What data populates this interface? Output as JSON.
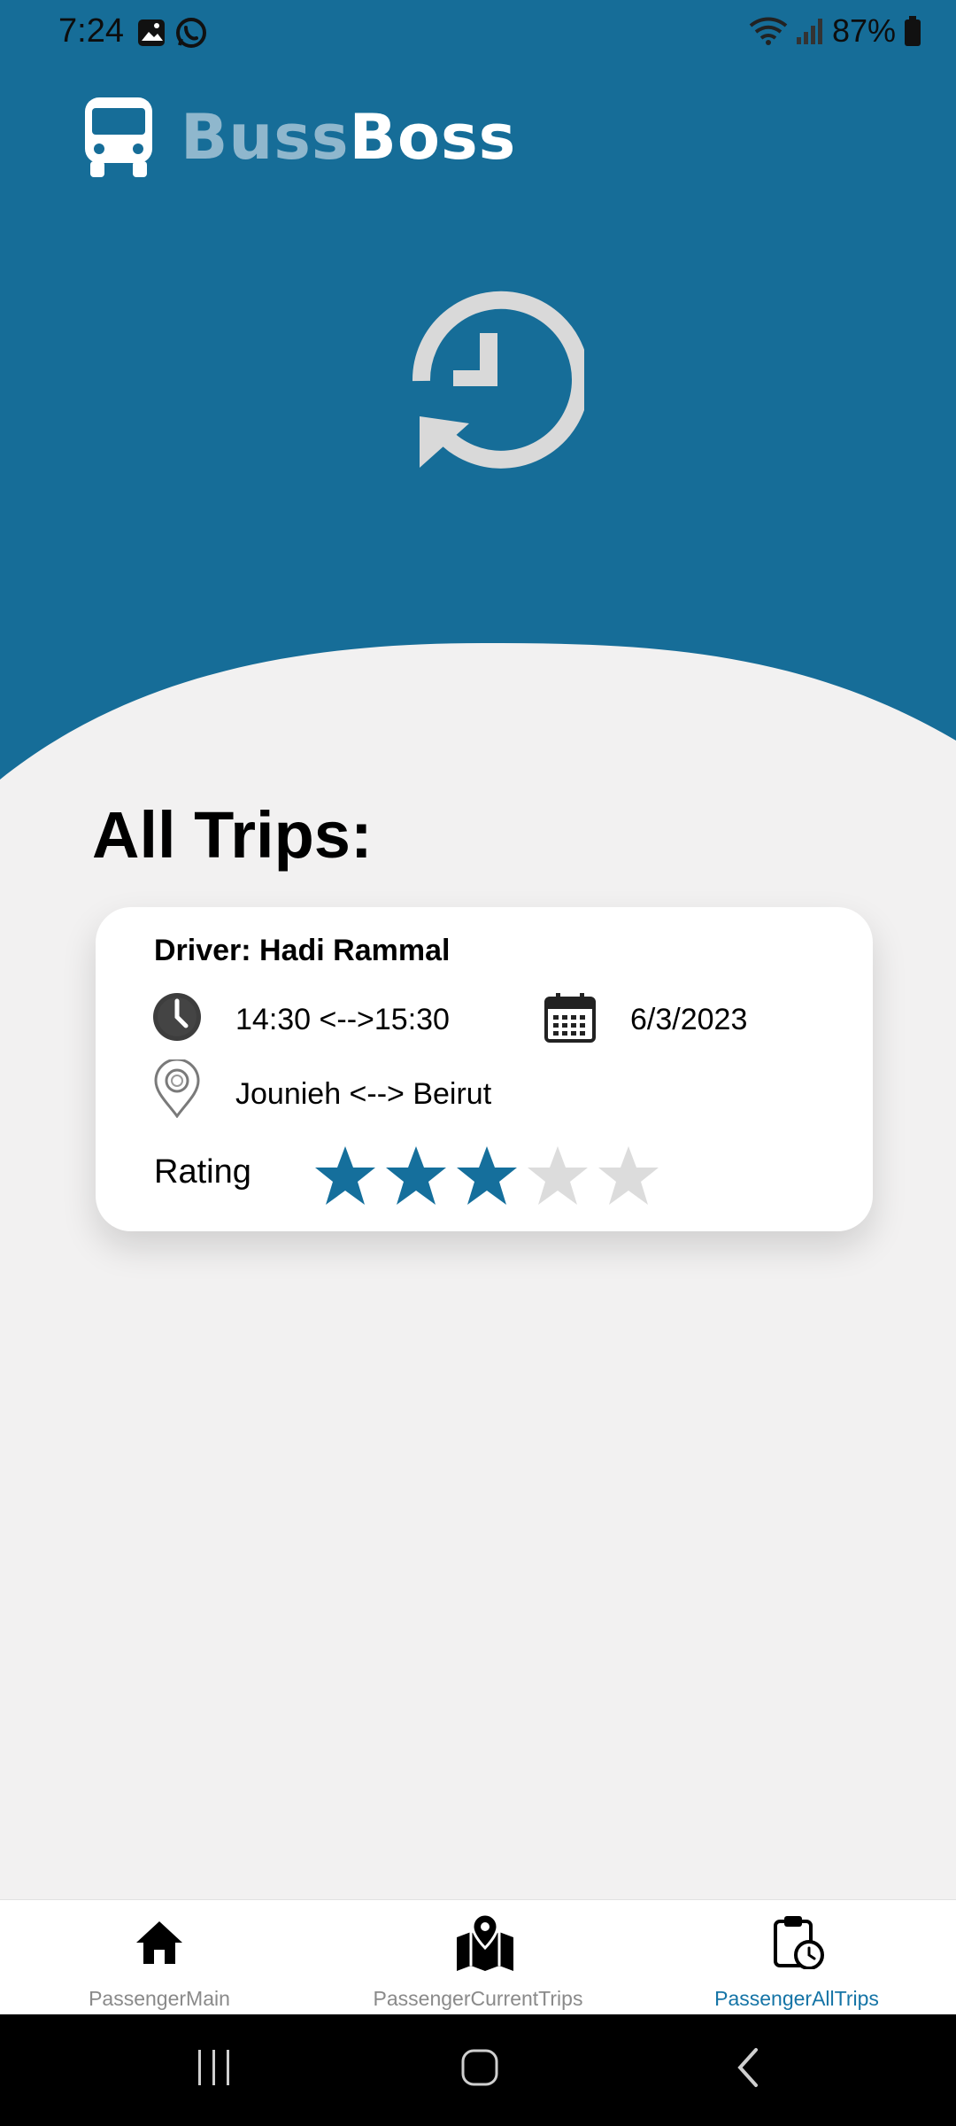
{
  "status_bar": {
    "time": "7:24",
    "battery": "87%"
  },
  "brand": {
    "name_part1": "Buss",
    "name_part2": "Boss",
    "accent": "#8fb7cd"
  },
  "colors": {
    "header": "#166d98",
    "primary": "#176d98",
    "star_filled": "#156f9c",
    "star_empty": "#dcdcdc",
    "background": "#f2f1f1"
  },
  "page": {
    "title": "All Trips:"
  },
  "trips": [
    {
      "driver": "Driver: Hadi Rammal",
      "time": "14:30 <-->15:30",
      "date": "6/3/2023",
      "route": "Jounieh <--> Beirut",
      "rating_label": "Rating",
      "rating": 3,
      "rating_max": 5
    }
  ],
  "nav": {
    "items": [
      {
        "label": "PassengerMain",
        "icon": "home-icon",
        "active": false
      },
      {
        "label": "PassengerCurrentTrips",
        "icon": "map-icon",
        "active": false
      },
      {
        "label": "PassengerAllTrips",
        "icon": "clipboard-clock-icon",
        "active": true
      }
    ]
  }
}
